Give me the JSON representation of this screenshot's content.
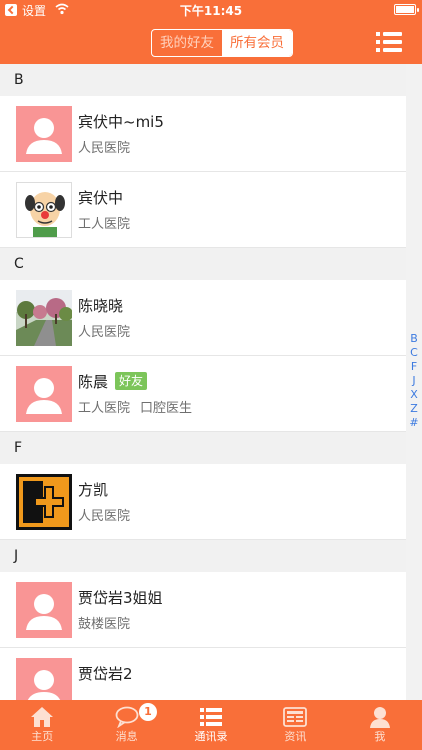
{
  "status_bar": {
    "carrier": "设置",
    "time": "下午11:45"
  },
  "header": {
    "segment": {
      "friends": "我的好友",
      "all_members": "所有会员"
    }
  },
  "sections": [
    {
      "letter": "B",
      "contacts": [
        {
          "name": "宾伏中~mi5",
          "hospital": "人民医院",
          "avatar": "placeholder-avatar"
        },
        {
          "name": "宾伏中",
          "hospital": "工人医院",
          "avatar": "cartoon-clown-avatar"
        }
      ]
    },
    {
      "letter": "C",
      "contacts": [
        {
          "name": "陈晓晓",
          "hospital": "人民医院",
          "avatar": "tree-road-photo"
        },
        {
          "name": "陈晨",
          "tag": "好友",
          "hospital": "工人医院",
          "department": "口腔医生",
          "avatar": "placeholder-avatar"
        }
      ]
    },
    {
      "letter": "F",
      "contacts": [
        {
          "name": "方凯",
          "hospital": "人民医院",
          "avatar": "orange-plus-logo"
        }
      ]
    },
    {
      "letter": "J",
      "contacts": [
        {
          "name": "贾岱岩3姐姐",
          "hospital": "鼓楼医院",
          "avatar": "placeholder-avatar"
        },
        {
          "name": "贾岱岩2",
          "avatar": "placeholder-avatar"
        }
      ]
    }
  ],
  "index_letters": [
    "B",
    "C",
    "F",
    "J",
    "X",
    "Z",
    "#"
  ],
  "tabbar": {
    "home": "主页",
    "messages": "消息",
    "messages_badge": "1",
    "contacts": "通讯录",
    "news": "资讯",
    "me": "我"
  },
  "colors": {
    "primary": "#f96f39",
    "avatar_bg": "#f99595",
    "friend_tag": "#7cc55a",
    "index": "#3d7be0"
  }
}
